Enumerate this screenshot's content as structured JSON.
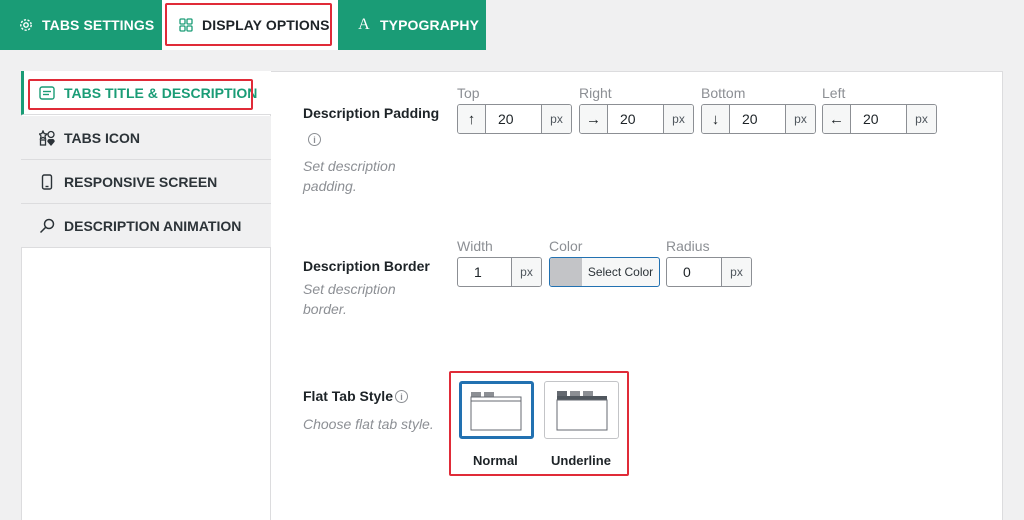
{
  "topbar": {
    "tabs": [
      {
        "label": "TABS SETTINGS",
        "icon": "gear-icon"
      },
      {
        "label": "DISPLAY OPTIONS",
        "icon": "grid-icon"
      },
      {
        "label": "TYPOGRAPHY",
        "icon": "font-icon"
      }
    ],
    "active_tab": "DISPLAY OPTIONS"
  },
  "sidebar": {
    "items": [
      {
        "label": "TABS TITLE & DESCRIPTION",
        "icon": "text-box-icon",
        "active": true
      },
      {
        "label": "TABS ICON",
        "icon": "shapes-icon"
      },
      {
        "label": "RESPONSIVE SCREEN",
        "icon": "mobile-icon"
      },
      {
        "label": "DESCRIPTION ANIMATION",
        "icon": "magic-icon"
      }
    ]
  },
  "padding": {
    "label": "Description Padding",
    "info_glyph": "i",
    "desc": "Set description padding.",
    "fields": [
      {
        "label": "Top",
        "arrow": "↑",
        "value": "20",
        "unit": "px"
      },
      {
        "label": "Right",
        "arrow": "→",
        "value": "20",
        "unit": "px"
      },
      {
        "label": "Bottom",
        "arrow": "↓",
        "value": "20",
        "unit": "px"
      },
      {
        "label": "Left",
        "arrow": "←",
        "value": "20",
        "unit": "px"
      }
    ]
  },
  "border": {
    "label": "Description Border",
    "desc": "Set description border.",
    "width": {
      "label": "Width",
      "value": "1",
      "unit": "px"
    },
    "color": {
      "label": "Color",
      "button": "Select Color",
      "swatch": "#c3c4c7"
    },
    "radius": {
      "label": "Radius",
      "value": "0",
      "unit": "px"
    }
  },
  "flat_style": {
    "label": "Flat Tab Style",
    "info_glyph": "i",
    "desc": "Choose flat tab style.",
    "options": [
      {
        "label": "Normal",
        "selected": true
      },
      {
        "label": "Underline",
        "selected": false
      }
    ]
  },
  "colors": {
    "accent": "#1a9c76",
    "highlight": "#e02b38",
    "selected": "#2271b1"
  }
}
